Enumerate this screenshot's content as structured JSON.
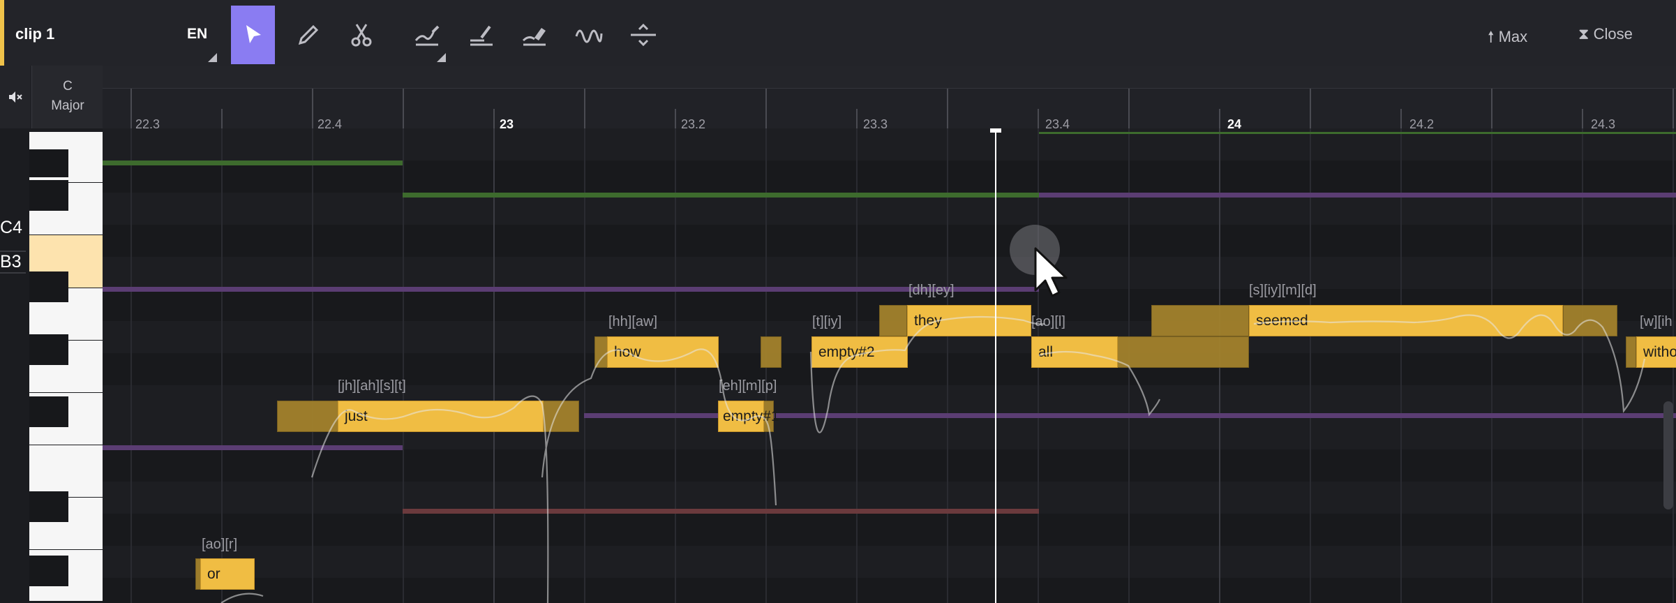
{
  "toolbar": {
    "clip_name": "clip 1",
    "language": "EN",
    "tools": [
      {
        "name": "select-tool",
        "icon": "arrow-pointer-icon",
        "active": true
      },
      {
        "name": "pencil-tool",
        "icon": "pencil-icon"
      },
      {
        "name": "scissors-tool",
        "icon": "scissors-icon"
      },
      {
        "name": "pitch-draw-tool",
        "icon": "pitch-curve-pencil-icon"
      },
      {
        "name": "pitch-line-tool",
        "icon": "pitch-line-pencil-icon"
      },
      {
        "name": "pitch-eraser-tool",
        "icon": "pitch-eraser-icon"
      },
      {
        "name": "vibrato-tool",
        "icon": "wave-icon"
      },
      {
        "name": "transition-tool",
        "icon": "transition-icon"
      }
    ],
    "max_label": "Max",
    "close_label": "Close"
  },
  "key": {
    "root": "C",
    "mode": "Major"
  },
  "piano": {
    "labels": [
      "C4",
      "B3"
    ]
  },
  "ruler": {
    "labels": [
      "22.3",
      "22.4",
      "23",
      "23.2",
      "23.3",
      "23.4",
      "24",
      "24.2",
      "24.3"
    ]
  },
  "notes": [
    {
      "lyric": "or",
      "phonemes": "[ao][r]"
    },
    {
      "lyric": "just",
      "phonemes": "[jh][ah][s][t]"
    },
    {
      "lyric": "how",
      "phonemes": "[hh][aw]"
    },
    {
      "lyric": "empty#1",
      "phonemes": "[eh][m][p]"
    },
    {
      "lyric": "empty#2",
      "phonemes": "[t][iy]"
    },
    {
      "lyric": "they",
      "phonemes": "[dh][ey]"
    },
    {
      "lyric": "all",
      "phonemes": "[ao][l]"
    },
    {
      "lyric": "seemed",
      "phonemes": "[s][iy][m][d]"
    },
    {
      "lyric": "witho",
      "phonemes": "[w][ih"
    }
  ],
  "colors": {
    "accent": "#8a7cf2",
    "note": "#f0bd43",
    "note_tail": "#a3822c",
    "track_green": "#3d6b2d",
    "track_purple": "#5b3d73",
    "track_red": "#6b3a3d"
  }
}
